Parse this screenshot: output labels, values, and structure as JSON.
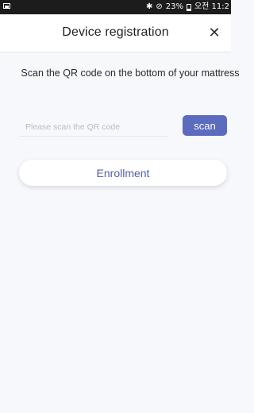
{
  "status_bar": {
    "bluetooth": "✱",
    "signal": "⊘",
    "battery_percent": "23%",
    "time": "오전 11:2"
  },
  "header": {
    "title": "Device registration",
    "close": "✕"
  },
  "instruction": "Scan the QR code on the bottom of your mattress",
  "qr_field": {
    "value": "",
    "placeholder": "Please scan the QR code"
  },
  "scan_label": "scan",
  "enroll_label": "Enrollment",
  "colors": {
    "accent": "#5b6bbd",
    "enroll_text": "#5460a8",
    "background": "#f7f8fb"
  }
}
